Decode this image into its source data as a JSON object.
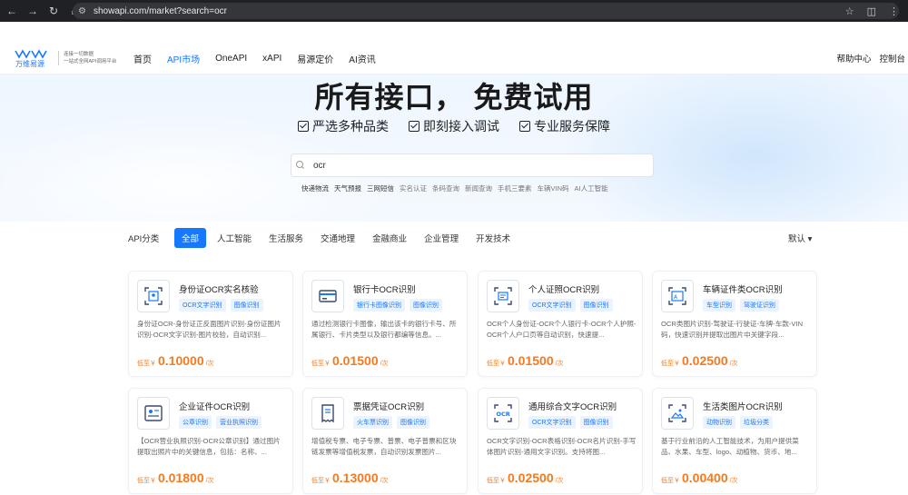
{
  "browser": {
    "url": "showapi.com/market?search=ocr"
  },
  "site": {
    "logo_text": "万维易源",
    "logo_sub_line1": "连接一切数据",
    "logo_sub_line2": "一站式全网API调用平台",
    "nav": [
      "首页",
      "API市场",
      "OneAPI",
      "xAPI",
      "易源定价",
      "AI资讯"
    ],
    "nav_active_index": 1,
    "help": "帮助中心",
    "console": "控制台"
  },
  "hero": {
    "title": "所有接口， 免费试用",
    "features": [
      "严选多种品类",
      "即刻接入调试",
      "专业服务保障"
    ],
    "search_value": "ocr",
    "hot_tags": [
      "快递物流",
      "天气预报",
      "三网短信",
      "实名认证",
      "条码查询",
      "新闻查询",
      "手机三要素",
      "车辆VIN码",
      "AI人工智能"
    ]
  },
  "filter": {
    "label": "API分类",
    "categories": [
      "全部",
      "人工智能",
      "生活服务",
      "交通地理",
      "金融商业",
      "企业管理",
      "开发技术"
    ],
    "sort": "默认"
  },
  "cards": [
    {
      "title": "身份证OCR实名核验",
      "tags": [
        "OCR文字识别",
        "图像识别"
      ],
      "desc": "身份证OCR-身份证正反面图片识别-身份证图片识别-OCR文字识别-图片校验，自动识别...",
      "price_prefix": "低至￥",
      "price": "0.10000",
      "unit": "/次"
    },
    {
      "title": "银行卡OCR识别",
      "tags": [
        "银行卡图像识别",
        "图像识别"
      ],
      "desc": "通过检测银行卡图像，输出该卡的银行卡号、所属银行、卡片类型以及银行都编等信息。...",
      "price_prefix": "低至￥",
      "price": "0.01500",
      "unit": "/次"
    },
    {
      "title": "个人证照OCR识别",
      "tags": [
        "OCR文字识别",
        "图像识别"
      ],
      "desc": "OCR个人身份证-OCR个人银行卡-OCR个人护照-OCR个人户口页等自动识别，快速提...",
      "price_prefix": "低至￥",
      "price": "0.01500",
      "unit": "/次"
    },
    {
      "title": "车辆证件类OCR识别",
      "tags": [
        "车型识别",
        "驾驶证识别"
      ],
      "desc": "OCR类图片识别-驾驶证-行驶证-车牌-车款-VIN码，快速识别并提取出图片中关键字段...",
      "price_prefix": "低至￥",
      "price": "0.02500",
      "unit": "/次"
    },
    {
      "title": "企业证件OCR识别",
      "tags": [
        "公章识别",
        "营业执照识别"
      ],
      "desc": "【OCR营业执照识别-OCR公章识别】通过图片提取出照片中的关键信息，包括：名称、...",
      "price_prefix": "低至￥",
      "price": "0.01800",
      "unit": "/次"
    },
    {
      "title": "票据凭证OCR识别",
      "tags": [
        "火车票识别",
        "图像识别"
      ],
      "desc": "增值税专票、电子专票、普票、电子普票和区块链发票等增值税发票，自动识别发票图片...",
      "price_prefix": "低至￥",
      "price": "0.13000",
      "unit": "/次"
    },
    {
      "title": "通用综合文字OCR识别",
      "tags": [
        "OCR文字识别",
        "图像识别"
      ],
      "desc": "OCR文字识别-OCR表格识别-OCR名片识别-手写体图片识别-通用文字识别。支持将图...",
      "price_prefix": "低至￥",
      "price": "0.02500",
      "unit": "/次"
    },
    {
      "title": "生活类图片OCR识别",
      "tags": [
        "动物识别",
        "垃圾分类"
      ],
      "desc": "基于行业前沿的人工智能技术，为用户提供菜品、水果、车型、logo、动植物、货币、地...",
      "price_prefix": "低至￥",
      "price": "0.00400",
      "unit": "/次"
    }
  ],
  "colors": {
    "accent": "#1677ff",
    "price": "#f57a1f"
  }
}
